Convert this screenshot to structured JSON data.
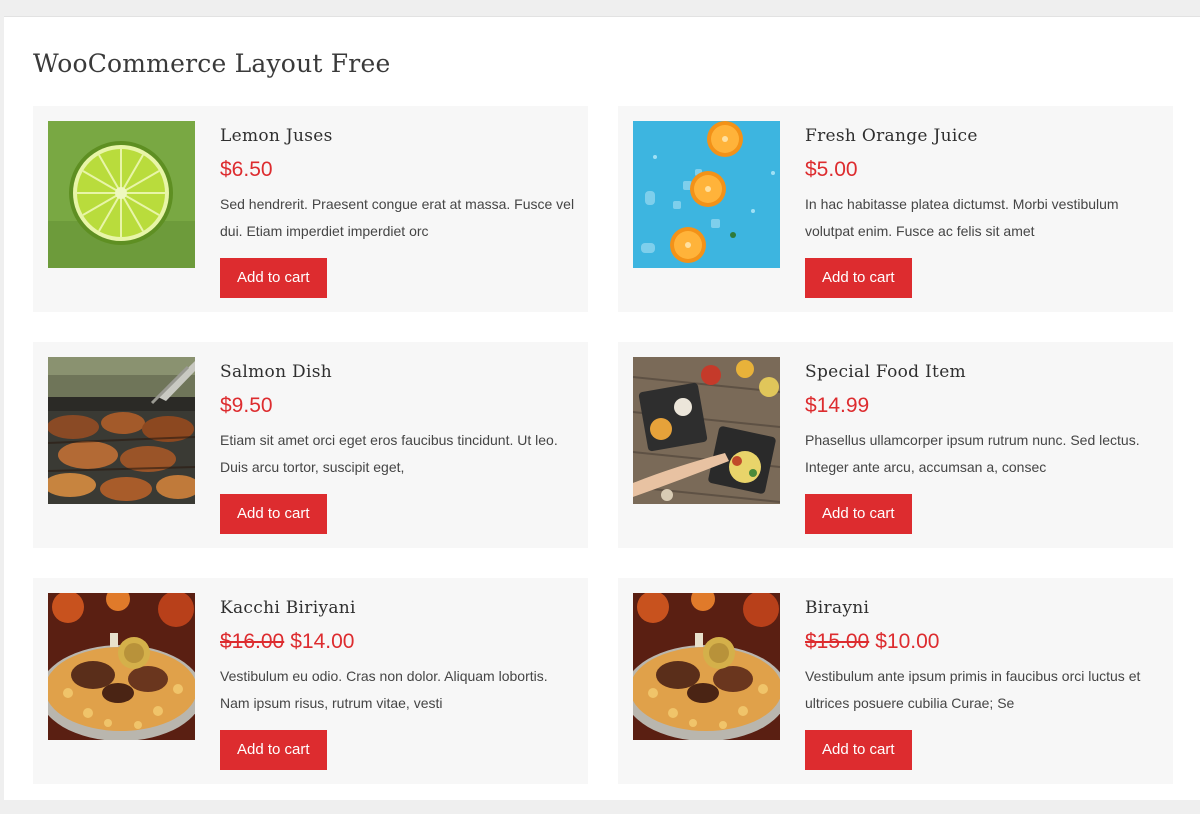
{
  "page": {
    "title": "WooCommerce Layout Free"
  },
  "products": [
    {
      "name": "Lemon Juses",
      "old_price": "",
      "price": "$6.50",
      "description": "Sed hendrerit. Praesent congue erat at massa. Fusce vel dui. Etiam imperdiet imperdiet orc",
      "button": "Add to cart",
      "image": "lime-slice-image"
    },
    {
      "name": "Fresh Orange Juice",
      "old_price": "",
      "price": "$5.00",
      "description": "In hac habitasse platea dictumst. Morbi vestibulum volutpat enim. Fusce ac felis sit amet",
      "button": "Add to cart",
      "image": "orange-slices-image"
    },
    {
      "name": "Salmon Dish",
      "old_price": "",
      "price": "$9.50",
      "description": "Etiam sit amet orci eget eros faucibus tincidunt. Ut leo. Duis arcu tortor, suscipit eget,",
      "button": "Add to cart",
      "image": "grilled-meat-image"
    },
    {
      "name": "Special Food Item",
      "old_price": "",
      "price": "$14.99",
      "description": "Phasellus ullamcorper ipsum rutrum nunc. Sed lectus. Integer ante arcu, accumsan a, consec",
      "button": "Add to cart",
      "image": "food-platter-image"
    },
    {
      "name": "Kacchi Biriyani",
      "old_price": "$16.00",
      "price": "$14.00",
      "description": "Vestibulum eu odio. Cras non dolor. Aliquam lobortis. Nam ipsum risus, rutrum vitae, vesti",
      "button": "Add to cart",
      "image": "biriyani-image"
    },
    {
      "name": "Birayni",
      "old_price": "$15.00",
      "price": "$10.00",
      "description": "Vestibulum ante ipsum primis in faucibus orci luctus et ultrices posuere cubilia Curae; Se",
      "button": "Add to cart",
      "image": "biriyani-image"
    }
  ],
  "colors": {
    "accent": "#dd2c2f",
    "card_bg": "#f7f7f7",
    "page_bg": "#efefef"
  }
}
